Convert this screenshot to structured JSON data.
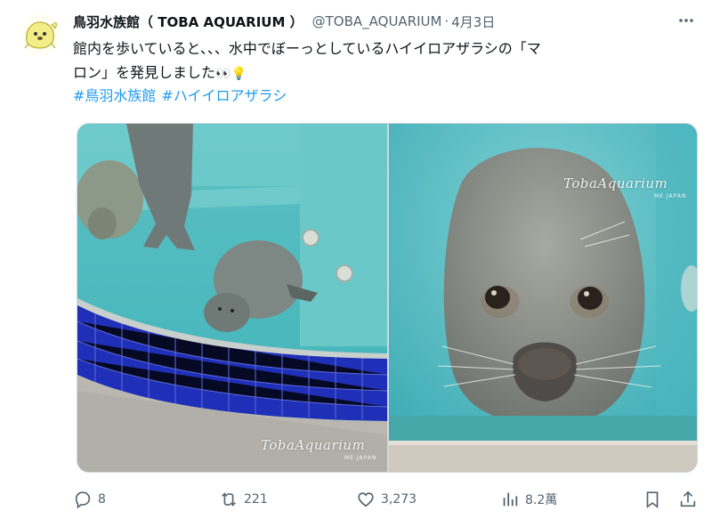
{
  "tweet": {
    "author_name": "鳥羽水族館（ TOBA AQUARIUM ）",
    "handle": "@TOBA_AQUARIUM",
    "separator": "·",
    "date": "4月3日",
    "text_line1": "館内を歩いていると、、、水中でぼーっとしているハイイロアザラシの「マ",
    "text_line2": "ロン」を発見しました",
    "emoji": "👀💡",
    "hashtags": [
      "#鳥羽水族館",
      "#ハイイロアザラシ"
    ]
  },
  "media": {
    "watermark_1": "TobaAquarium",
    "watermark_1_sub": "ME JAPAN",
    "watermark_2": "TobaAquarium",
    "watermark_2_sub": "ME JAPAN"
  },
  "actions": {
    "replies": "8",
    "reposts": "221",
    "likes": "3,273",
    "views": "8.2萬"
  },
  "icons": {
    "more": "more-icon",
    "reply": "reply-icon",
    "repost": "repost-icon",
    "like": "heart-icon",
    "views": "views-icon",
    "bookmark": "bookmark-icon",
    "share": "share-icon"
  },
  "colors": {
    "link": "#1d9bf0",
    "secondary_text": "#536471",
    "primary_text": "#0f1419"
  }
}
